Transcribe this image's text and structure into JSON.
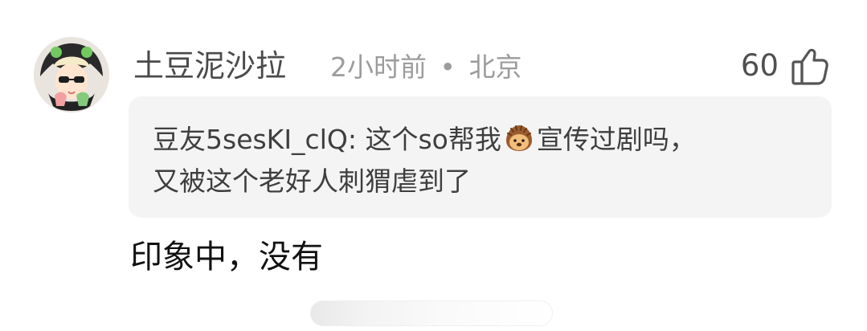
{
  "comment": {
    "username": "土豆泥沙拉",
    "time": "2小时前",
    "separator": "•",
    "location": "北京",
    "likes": "60",
    "like_icon": "thumbs-up-icon",
    "quote": {
      "author": "豆友5sesKI_clQ:",
      "text_before": "这个so帮我",
      "emoji": "hedgehog-emoji",
      "text_after": "宣传过剧吗，",
      "line2": "又被这个老好人刺猬虐到了"
    },
    "reply": "印象中，没有",
    "colors": {
      "username": "#4a4a4a",
      "meta": "#9c9c9c",
      "quote_bg": "#f4f4f4"
    }
  }
}
